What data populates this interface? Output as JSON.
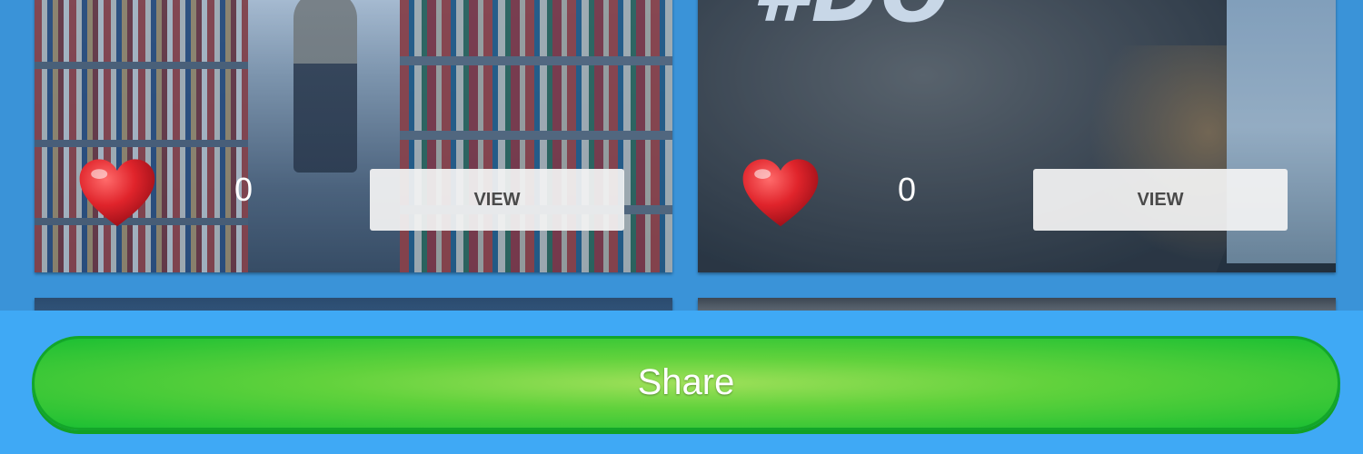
{
  "cards": [
    {
      "image_alt": "library aisle photo",
      "likes_count": "0",
      "view_label": "VIEW"
    },
    {
      "image_alt": "mountain rock photo",
      "title_fragment": "#DO",
      "likes_count": "0",
      "view_label": "VIEW"
    }
  ],
  "share": {
    "label": "Share"
  },
  "colors": {
    "background": "#3a93d8",
    "share_bar": "#3fa9f5",
    "share_button": "#1bbf33",
    "heart": "#d61f26",
    "view_button": "#f3f3f3"
  },
  "icons": {
    "like": "heart-icon"
  }
}
